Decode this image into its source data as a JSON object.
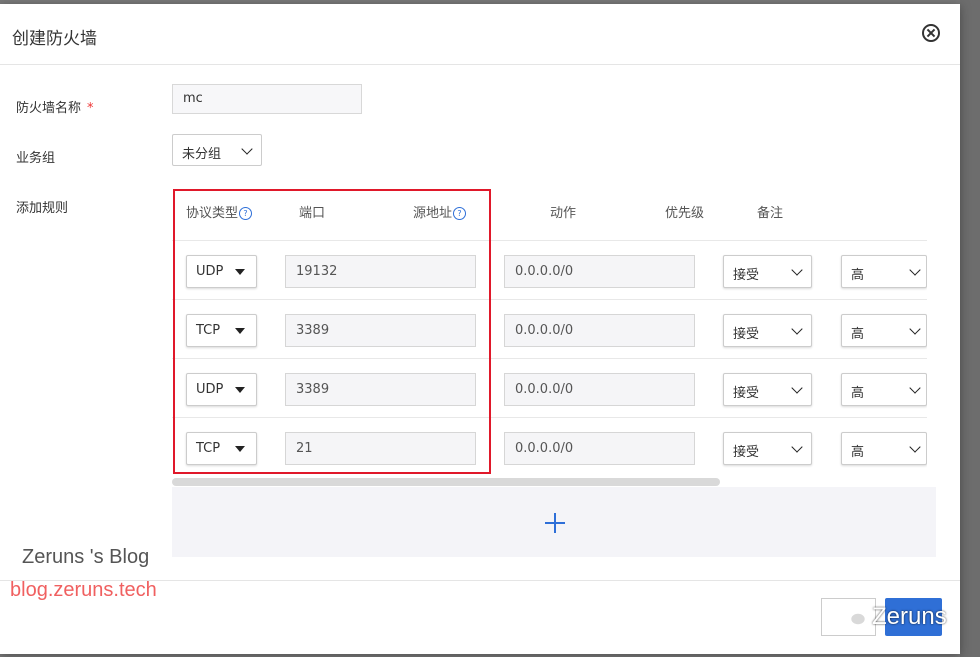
{
  "dialog": {
    "title": "创建防火墙"
  },
  "form": {
    "name_label": "防火墙名称",
    "required_mark": "*",
    "name_value": "mc",
    "group_label": "业务组",
    "group_value": "未分组",
    "rules_label": "添加规则"
  },
  "rules": {
    "columns": [
      "协议类型",
      "端口",
      "源地址",
      "动作",
      "优先级",
      "备注"
    ],
    "help_glyph": "?",
    "rows": [
      {
        "protocol": "UDP",
        "port": "19132",
        "source": "0.0.0.0/0",
        "action": "接受",
        "priority": "高"
      },
      {
        "protocol": "TCP",
        "port": "3389",
        "source": "0.0.0.0/0",
        "action": "接受",
        "priority": "高"
      },
      {
        "protocol": "UDP",
        "port": "3389",
        "source": "0.0.0.0/0",
        "action": "接受",
        "priority": "高"
      },
      {
        "protocol": "TCP",
        "port": "21",
        "source": "0.0.0.0/0",
        "action": "接受",
        "priority": "高"
      }
    ]
  },
  "watermark": {
    "blog_name": "Zeruns 's Blog",
    "blog_url": "blog.zeruns.tech",
    "wechat_name": "Zeruns"
  },
  "colors": {
    "highlight": "#e0182a",
    "primary": "#2f6fd6",
    "required": "#e33333"
  },
  "icons": {
    "close": "close-circle-icon",
    "add": "plus-icon",
    "help": "question-circle-icon",
    "wechat": "wechat-icon"
  }
}
